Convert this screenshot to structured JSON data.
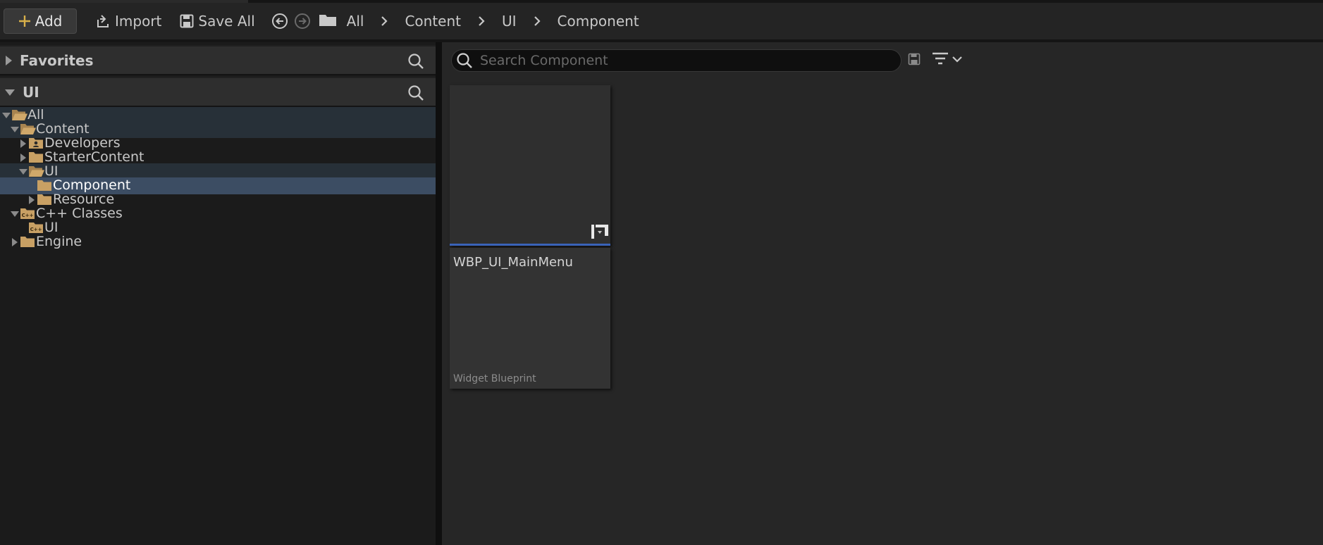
{
  "toolbar": {
    "add_label": "Add",
    "import_label": "Import",
    "save_all_label": "Save All"
  },
  "breadcrumb": [
    "All",
    "Content",
    "UI",
    "Component"
  ],
  "left_panel": {
    "favorites_label": "Favorites",
    "collection_label": "UI",
    "tree": [
      {
        "label": "All",
        "depth": 0,
        "expanded": true,
        "highlight": "parent"
      },
      {
        "label": "Content",
        "depth": 1,
        "expanded": true,
        "highlight": "parent"
      },
      {
        "label": "Developers",
        "depth": 2,
        "expanded": false,
        "highlight": "none"
      },
      {
        "label": "StarterContent",
        "depth": 2,
        "expanded": false,
        "highlight": "none"
      },
      {
        "label": "UI",
        "depth": 2,
        "expanded": true,
        "highlight": "parent"
      },
      {
        "label": "Component",
        "depth": 3,
        "expanded": null,
        "highlight": "selected"
      },
      {
        "label": "Resource",
        "depth": 3,
        "expanded": false,
        "highlight": "none"
      },
      {
        "label": "C++ Classes",
        "depth": 1,
        "expanded": true,
        "highlight": "none"
      },
      {
        "label": "UI",
        "depth": 2,
        "expanded": null,
        "highlight": "none"
      },
      {
        "label": "Engine",
        "depth": 1,
        "expanded": false,
        "highlight": "none"
      }
    ]
  },
  "content": {
    "search_placeholder": "Search Component",
    "assets": [
      {
        "name": "WBP_UI_MainMenu",
        "type": "Widget Blueprint"
      }
    ]
  },
  "colors": {
    "selected_row": "#3c4d63",
    "parent_row": "#273038",
    "folder": "#c8a064",
    "tile_accent": "#3a63b8",
    "add_plus": "#d8b04a"
  }
}
